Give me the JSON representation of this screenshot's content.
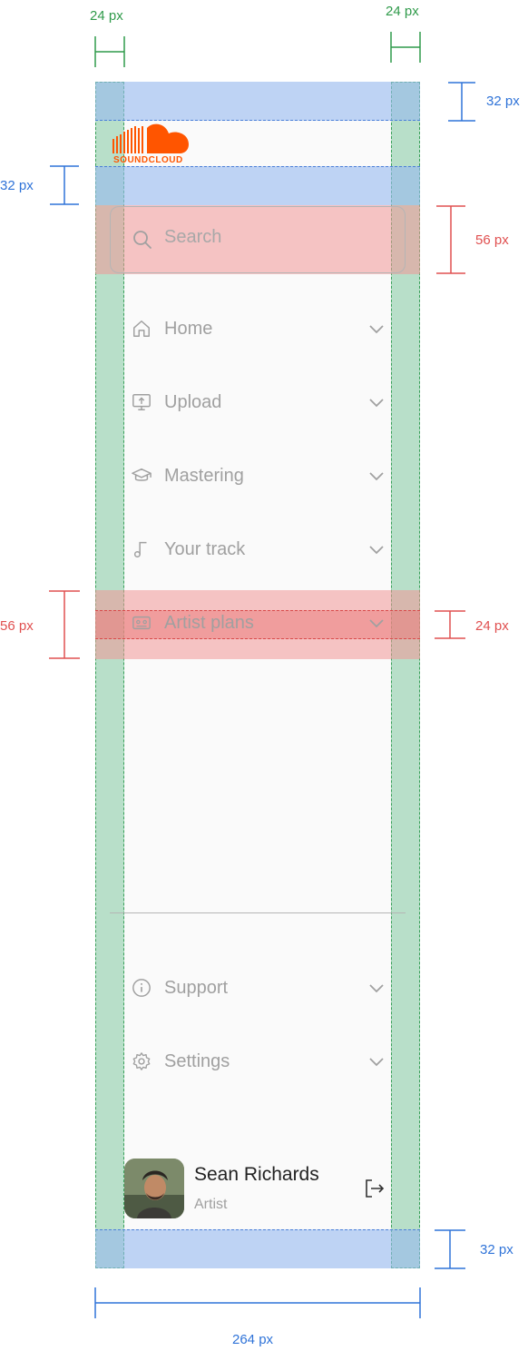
{
  "logo": {
    "text": "SOUNDCLOUD",
    "color": "#ff5500"
  },
  "search": {
    "placeholder": "Search"
  },
  "nav": {
    "items": [
      {
        "label": "Home",
        "icon": "home-icon"
      },
      {
        "label": "Upload",
        "icon": "upload-icon"
      },
      {
        "label": "Mastering",
        "icon": "graduation-cap-icon"
      },
      {
        "label": "Your track",
        "icon": "music-note-icon"
      },
      {
        "label": "Artist plans",
        "icon": "cassette-icon"
      }
    ],
    "footer_items": [
      {
        "label": "Support",
        "icon": "info-icon"
      },
      {
        "label": "Settings",
        "icon": "gear-icon"
      }
    ]
  },
  "user": {
    "name": "Sean Richards",
    "role": "Artist"
  },
  "annotations": {
    "side_padding_left": "24 px",
    "side_padding_right": "24 px",
    "top_padding": "32 px",
    "logo_gap": "32 px",
    "search_height": "56 px",
    "item_height": "56 px",
    "icon_size": "24 px",
    "bottom_padding": "32 px",
    "panel_width": "264 px"
  },
  "colors": {
    "accent": "#ff5500",
    "measure_green": "#2f9a4a",
    "measure_blue": "#2f73d8",
    "measure_red": "#e05050"
  }
}
